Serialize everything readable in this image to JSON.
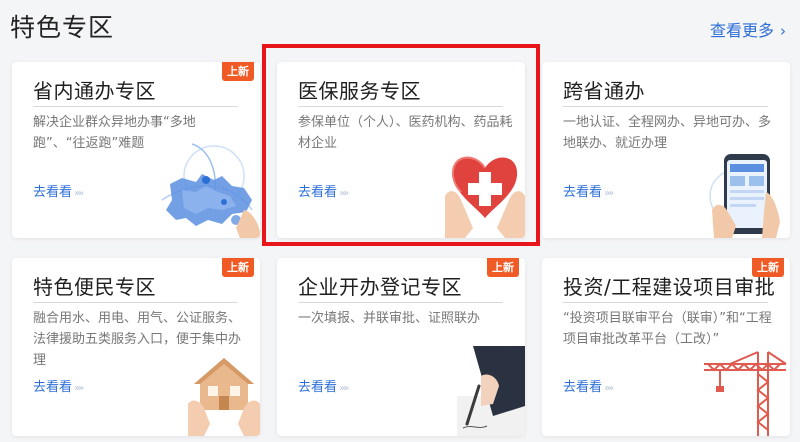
{
  "header": {
    "title": "特色专区",
    "view_more": "查看更多",
    "view_more_chevron": "›"
  },
  "cards": [
    {
      "title": "省内通办专区",
      "desc": "解决企业群众异地办事“多地跑”、“往返跑”难题",
      "goto": "去看看",
      "badge": "上新",
      "icon": "province-map-icon"
    },
    {
      "title": "医保服务专区",
      "desc": "参保单位（个人）、医药机构、药品耗材企业",
      "goto": "去看看",
      "badge": "",
      "icon": "heart-cross-hands-icon"
    },
    {
      "title": "跨省通办",
      "desc": "一地认证、全程网办、异地可办、多地联办、就近办理",
      "goto": "去看看",
      "badge": "",
      "icon": "mobile-phone-icon"
    },
    {
      "title": "特色便民专区",
      "desc": "融合用水、用电、用气、公证服务、法律援助五类服务入口，便于集中办理",
      "goto": "去看看",
      "badge": "上新",
      "icon": "house-hands-icon"
    },
    {
      "title": "企业开办登记专区",
      "desc": "一次填报、并联审批、证照联办",
      "goto": "去看看",
      "badge": "上新",
      "icon": "signing-pen-icon"
    },
    {
      "title": "投资/工程建设项目审批",
      "desc": "“投资项目联审平台（联审）”和“工程项目审批改革平台（工改）”",
      "goto": "去看看",
      "badge": "上新",
      "icon": "tower-crane-icon"
    }
  ],
  "goto_arrows": "»»",
  "colors": {
    "accent": "#2d6fd8",
    "badge": "#ef5a25",
    "highlight": "#e8151b"
  }
}
